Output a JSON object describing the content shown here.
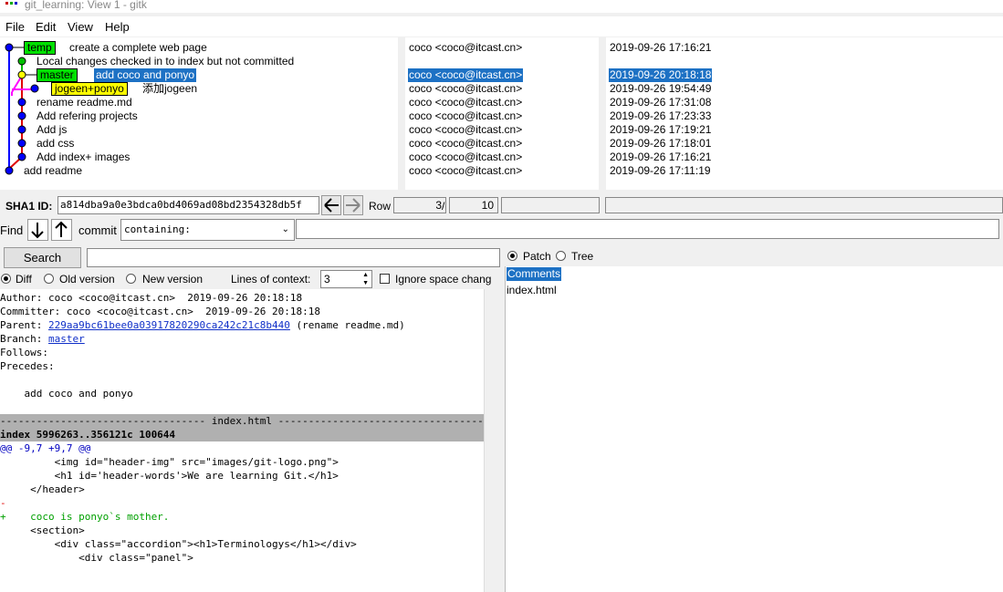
{
  "window": {
    "title": "git_learning: View 1 - gitk"
  },
  "menu": [
    "File",
    "Edit",
    "View",
    "Help"
  ],
  "commits": [
    {
      "subject": "create a complete web page",
      "author": "coco <coco@itcast.cn>",
      "date": "2019-09-26 17:16:21",
      "tags": [
        "temp"
      ]
    },
    {
      "subject": "Local changes checked in to index but not committed",
      "author": "",
      "date": "",
      "tags": []
    },
    {
      "subject": "add coco and ponyo",
      "author": "coco <coco@itcast.cn>",
      "date": "2019-09-26 20:18:18",
      "tags": [
        "master"
      ],
      "selected": true
    },
    {
      "subject": "添加jogeen",
      "author": "coco <coco@itcast.cn>",
      "date": "2019-09-26 19:54:49",
      "tags": [
        "jogeen+ponyo"
      ]
    },
    {
      "subject": "rename readme.md",
      "author": "coco <coco@itcast.cn>",
      "date": "2019-09-26 17:31:08",
      "tags": []
    },
    {
      "subject": "Add refering projects",
      "author": "coco <coco@itcast.cn>",
      "date": "2019-09-26 17:23:33",
      "tags": []
    },
    {
      "subject": "Add js",
      "author": "coco <coco@itcast.cn>",
      "date": "2019-09-26 17:19:21",
      "tags": []
    },
    {
      "subject": "add css",
      "author": "coco <coco@itcast.cn>",
      "date": "2019-09-26 17:18:01",
      "tags": []
    },
    {
      "subject": "Add index+ images",
      "author": "coco <coco@itcast.cn>",
      "date": "2019-09-26 17:16:21",
      "tags": []
    },
    {
      "subject": "add readme",
      "author": "coco <coco@itcast.cn>",
      "date": "2019-09-26 17:11:19",
      "tags": []
    }
  ],
  "sha": {
    "label": "SHA1 ID:",
    "value": "a814dba9a0e3bdca0bd4069ad08bd2354328db5f",
    "row_label": "Row",
    "row_current": "3",
    "row_sep": "/",
    "row_total": "10"
  },
  "find": {
    "label": "Find",
    "mode_label": "commit",
    "mode_value": "containing:",
    "search_button": "Search"
  },
  "diff_options": {
    "diff": "Diff",
    "old_version": "Old version",
    "new_version": "New version",
    "context_label": "Lines of context:",
    "context_value": "3",
    "ignore_space": "Ignore space chang"
  },
  "commit_info": {
    "author": "Author: coco <coco@itcast.cn>  2019-09-26 20:18:18",
    "committer": "Committer: coco <coco@itcast.cn>  2019-09-26 20:18:18",
    "parent_prefix": "Parent: ",
    "parent_hash": "229aa9bc61bee0a03917820290ca242c21c8b440",
    "parent_suffix": " (rename readme.md)",
    "branch_prefix": "Branch: ",
    "branch": "master",
    "follows": "Follows:",
    "precedes": "Precedes:",
    "message": "    add coco and ponyo"
  },
  "diff": {
    "file_header": "---------------------------------- index.html ----------------------------------",
    "index_line": "index 5996263..356121c 100644",
    "hunk": "@@ -9,7 +9,7 @@",
    "lines": [
      {
        "kind": "ctx",
        "text": "         <img id=\"header-img\" src=\"images/git-logo.png\">"
      },
      {
        "kind": "ctx",
        "text": "         <h1 id='header-words'>We are learning Git.</h1>"
      },
      {
        "kind": "ctx",
        "text": "     </header>"
      },
      {
        "kind": "del",
        "text": "-"
      },
      {
        "kind": "add",
        "text": "+    coco is ponyo`s mother."
      },
      {
        "kind": "ctx",
        "text": "     <section>"
      },
      {
        "kind": "ctx",
        "text": "         <div class=\"accordion\"><h1>Terminologys</h1></div>"
      },
      {
        "kind": "ctx",
        "text": "             <div class=\"panel\">"
      }
    ]
  },
  "files_pane": {
    "patch": "Patch",
    "tree": "Tree",
    "items": [
      "Comments",
      "index.html"
    ]
  },
  "colors": {
    "selection": "#1d71c4",
    "tag_green": "#00e000",
    "tag_yellow": "#ffff00",
    "graph_blue": "#0000ff",
    "graph_red": "#e00000",
    "graph_magenta": "#ff00ff",
    "graph_green": "#00c000",
    "diff_add": "#00a000",
    "diff_del": "#e00000",
    "hunk": "#0000c0"
  }
}
